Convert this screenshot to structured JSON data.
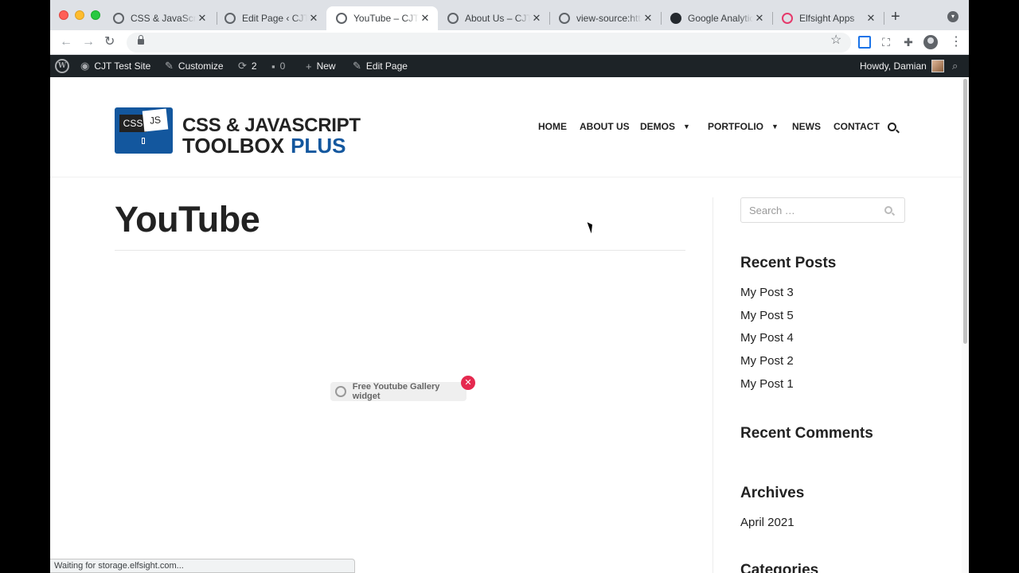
{
  "browser": {
    "tabs": [
      {
        "title": "CSS & JavaScript Toolbox",
        "icon": "globe-icon"
      },
      {
        "title": "Edit Page ‹ CJT Test Site",
        "icon": "globe-icon"
      },
      {
        "title": "YouTube – CJT Test Site",
        "icon": "globe-icon",
        "active": true
      },
      {
        "title": "About Us – CJT Test Site",
        "icon": "globe-icon"
      },
      {
        "title": "view-source:https://",
        "icon": "globe-icon"
      },
      {
        "title": "Google Analytics",
        "icon": "github-icon"
      },
      {
        "title": "Elfsight Apps",
        "icon": "elfsight-icon"
      }
    ],
    "close_glyph": "✕",
    "new_tab_glyph": "+",
    "status_text": "Waiting for storage.elfsight.com..."
  },
  "adminbar": {
    "site_name": "CJT Test Site",
    "customize": "Customize",
    "updates_count": "2",
    "comments_count": "0",
    "new_label": "New",
    "edit_label": "Edit Page",
    "howdy": "Howdy, Damian"
  },
  "header": {
    "logo_css": "CSS",
    "logo_js": "JS",
    "logo_line1": "CSS & JAVASCRIPT",
    "logo_line2": "TOOLBOX",
    "logo_plus": "PLUS",
    "nav": {
      "home": "HOME",
      "about": "ABOUT US",
      "demos": "DEMOS",
      "portfolio": "PORTFOLIO",
      "news": "NEWS",
      "contact": "CONTACT"
    }
  },
  "content": {
    "title": "YouTube",
    "widget_badge": "Free Youtube Gallery widget"
  },
  "sidebar": {
    "search_placeholder": "Search …",
    "recent_posts_title": "Recent Posts",
    "recent_posts": [
      "My Post 3",
      "My Post 5",
      "My Post 4",
      "My Post 2",
      "My Post 1"
    ],
    "recent_comments_title": "Recent Comments",
    "archives_title": "Archives",
    "archives": [
      "April 2021"
    ],
    "categories_title": "Categories"
  },
  "colors": {
    "brand_blue": "#13579e",
    "adminbar_bg": "#1d2327",
    "badge_close": "#e5294f"
  }
}
